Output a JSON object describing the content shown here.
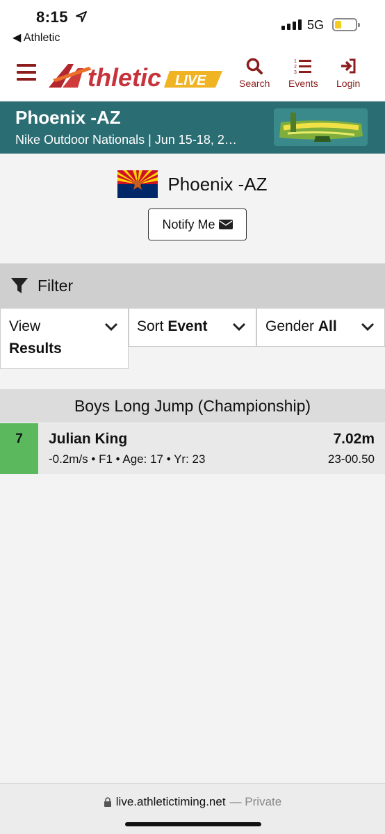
{
  "status_bar": {
    "time": "8:15",
    "back_app": "◀ Athletic",
    "network": "5G"
  },
  "header": {
    "logo_main": "thletic",
    "logo_badge": "LIVE",
    "nav": [
      {
        "label": "Search",
        "icon": "search-icon"
      },
      {
        "label": "Events",
        "icon": "list-icon"
      },
      {
        "label": "Login",
        "icon": "login-icon"
      }
    ]
  },
  "banner": {
    "title": "Phoenix -AZ",
    "subtitle": "Nike Outdoor Nationals | Jun 15-18, 2…"
  },
  "team": {
    "name": "Phoenix -AZ",
    "notify_label": "Notify Me"
  },
  "filter": {
    "label": "Filter",
    "view": {
      "prefix": "View",
      "value": "Results"
    },
    "sort": {
      "prefix": "Sort",
      "value": "Event"
    },
    "gender": {
      "prefix": "Gender",
      "value": "All"
    }
  },
  "results": {
    "event_title": "Boys Long Jump (Championship)",
    "rows": [
      {
        "place": "7",
        "athlete": "Julian King",
        "details": "-0.2m/s • F1 • Age: 17 • Yr: 23",
        "mark": "7.02m",
        "mark_imperial": "23-00.50"
      }
    ]
  },
  "browser": {
    "url": "live.athletictiming.net",
    "mode": "— Private"
  },
  "colors": {
    "brand": "#8b1d1d",
    "banner": "#2a6d73",
    "place_badge": "#5cb85c"
  }
}
